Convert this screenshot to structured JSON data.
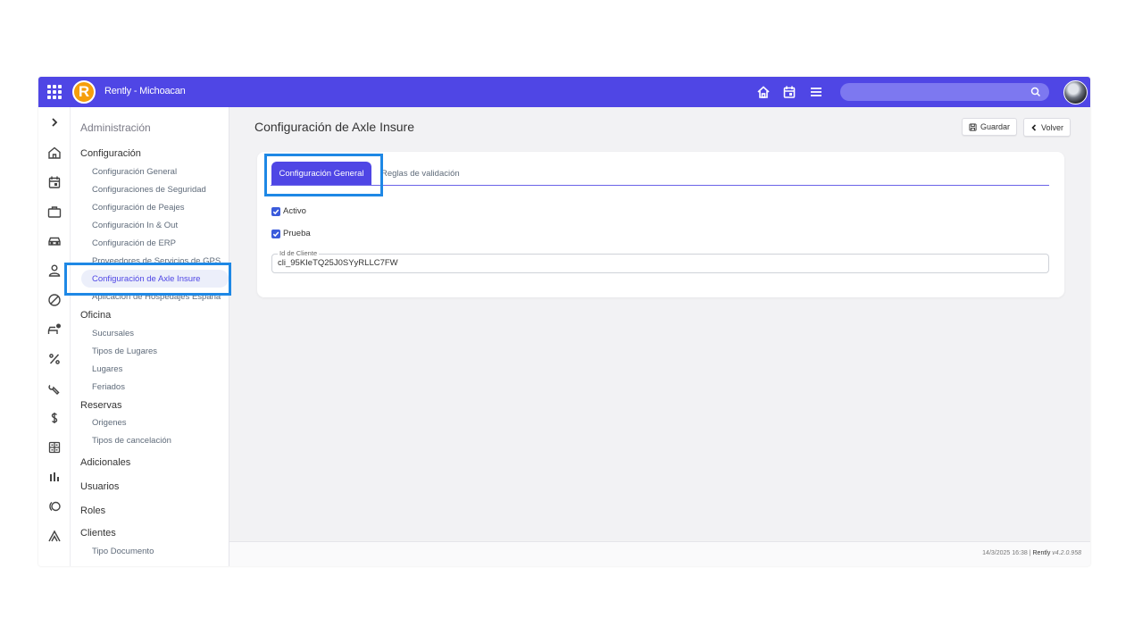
{
  "header": {
    "logo_letter": "R",
    "company": "Rently - Michoacan",
    "search": {
      "placeholder": ""
    }
  },
  "menu": {
    "title": "Administración",
    "sections": [
      {
        "label": "Configuración",
        "items": [
          "Configuración General",
          "Configuraciones de Seguridad",
          "Configuración de Peajes",
          "Configuración In & Out",
          "Configuración de ERP",
          "Proveedores de Servicios de GPS",
          "Configuración de Axle Insure",
          "Aplicación de Hospedajes España"
        ]
      },
      {
        "label": "Oficina",
        "items": [
          "Sucursales",
          "Tipos de Lugares",
          "Lugares",
          "Feriados"
        ]
      },
      {
        "label": "Reservas",
        "items": [
          "Origenes",
          "Tipos de cancelación"
        ]
      },
      {
        "label": "Adicionales",
        "items": []
      },
      {
        "label": "Usuarios",
        "items": []
      },
      {
        "label": "Roles",
        "items": []
      },
      {
        "label": "Clientes",
        "items": [
          "Tipo Documento"
        ]
      }
    ],
    "active_item": "Configuración de Axle Insure"
  },
  "content": {
    "title": "Configuración de Axle Insure",
    "save_label": "Guardar",
    "back_label": "Volver",
    "tabs": [
      {
        "label": "Configuración General",
        "active": true
      },
      {
        "label": "Reglas de validación",
        "active": false
      }
    ],
    "checkboxes": [
      {
        "label": "Activo",
        "checked": true
      },
      {
        "label": "Prueba",
        "checked": true
      }
    ],
    "client_id": {
      "label": "Id de Cliente",
      "value": "cli_95KIeTQ25J0SYyRLLC7FW"
    }
  },
  "footer": {
    "datetime": "14/3/2025 16:38",
    "separator": "|",
    "brand": "Rently",
    "version": "v4.2.0.958"
  },
  "colors": {
    "accent": "#4f46e5",
    "highlight": "#1e88e5"
  }
}
